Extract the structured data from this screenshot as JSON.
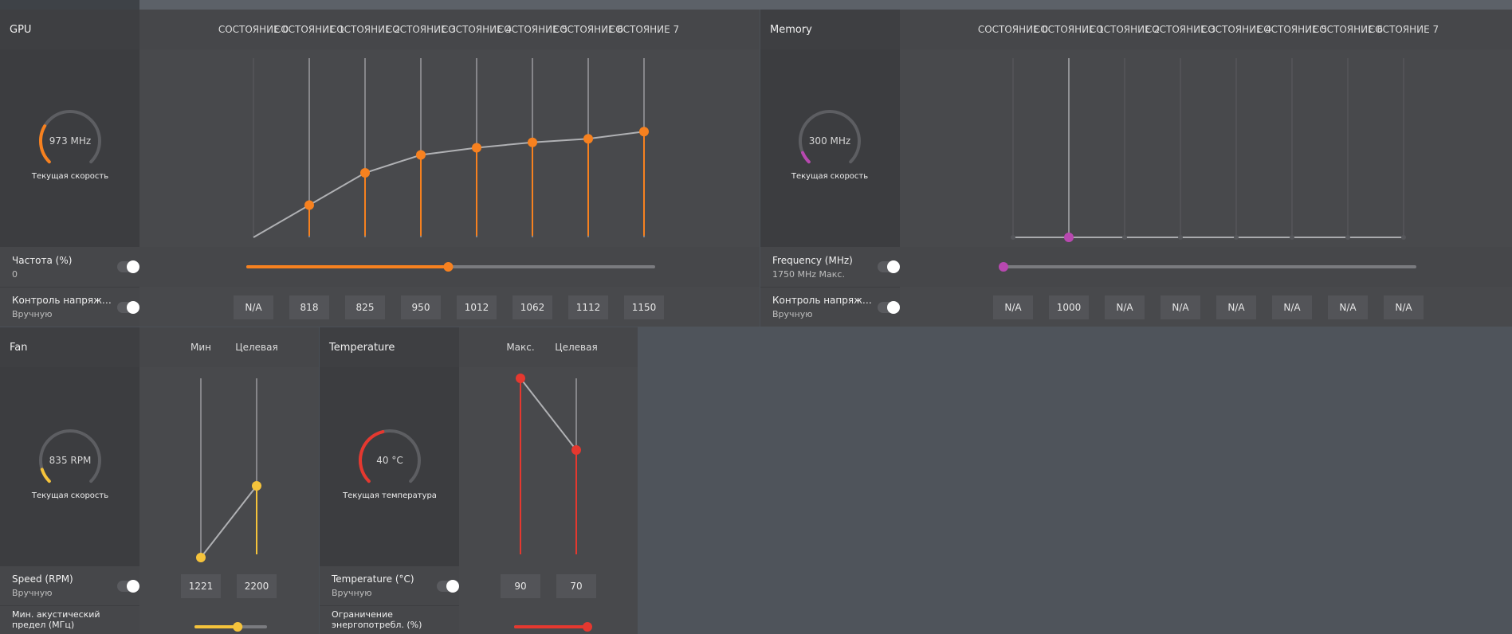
{
  "gpu": {
    "title": "GPU",
    "state_labels": [
      "СОСТОЯНИЕ 0",
      "СОСТОЯНИЕ 1",
      "СОСТОЯНИЕ 2",
      "СОСТОЯНИЕ 3",
      "СОСТОЯНИЕ 4",
      "СОСТОЯНИЕ 5",
      "СОСТОЯНИЕ 6",
      "СОСТОЯНИЕ 7"
    ],
    "gauge_value": "973 MHz",
    "gauge_caption": "Текущая скорость",
    "gauge_fraction": 0.28,
    "freq_label": "Частота (%)",
    "freq_value": "0",
    "voltage_label": "Контроль напряжен...",
    "voltage_mode": "Вручную",
    "voltages": [
      "N/A",
      "818",
      "825",
      "950",
      "1012",
      "1062",
      "1112",
      "1150"
    ],
    "slider_fraction": 0.494,
    "curve_points": [
      0.0,
      0.18,
      0.36,
      0.46,
      0.5,
      0.53,
      0.55,
      0.59
    ],
    "accent": "#f7811f"
  },
  "memory": {
    "title": "Memory",
    "state_labels": [
      "СОСТОЯНИЕ 0",
      "СОСТОЯНИЕ 1",
      "СОСТОЯНИЕ 2",
      "СОСТОЯНИЕ 3",
      "СОСТОЯНИЕ 4",
      "СОСТОЯНИЕ 5",
      "СОСТОЯНИЕ 6",
      "СОСТОЯНИЕ 7"
    ],
    "gauge_value": "300 MHz",
    "gauge_caption": "Текущая скорость",
    "gauge_fraction": 0.08,
    "freq_label": "Frequency (MHz)",
    "freq_value": "1750 MHz Макс.",
    "voltage_label": "Контроль напряжен...",
    "voltage_mode": "Вручную",
    "voltages": [
      "N/A",
      "1000",
      "N/A",
      "N/A",
      "N/A",
      "N/A",
      "N/A",
      "N/A"
    ],
    "active_state": 1,
    "slider_fraction": 0.0,
    "accent": "#b848b0"
  },
  "fan": {
    "title": "Fan",
    "col_min": "Мин",
    "col_target": "Целевая",
    "gauge_value": "835 RPM",
    "gauge_caption": "Текущая скорость",
    "gauge_fraction": 0.1,
    "speed_label": "Speed (RPM)",
    "speed_mode": "Вручную",
    "min_value": "1221",
    "target_value": "2200",
    "min_fraction": 0.0,
    "target_fraction": 0.4,
    "acoustic_label": "Мин. акустический предел (МГц)",
    "acoustic_fraction": 0.6,
    "accent": "#f5c33b"
  },
  "temperature": {
    "title": "Temperature",
    "col_max": "Макс.",
    "col_target": "Целевая",
    "gauge_value": "40 °C",
    "gauge_caption": "Текущая температура",
    "gauge_fraction": 0.45,
    "temp_label": "Temperature (°C)",
    "temp_mode": "Вручную",
    "max_value": "90",
    "target_value": "70",
    "max_fraction": 1.0,
    "target_fraction": 0.6,
    "power_label": "Ограничение энергопотребл. (%)",
    "power_fraction": 1.0,
    "accent": "#e5382f"
  }
}
